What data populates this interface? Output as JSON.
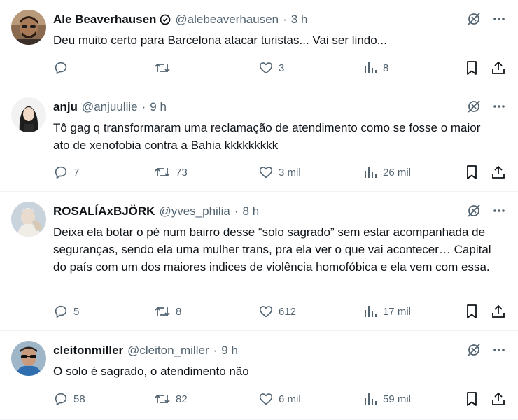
{
  "tweets": [
    {
      "name": "Ale Beaverhausen",
      "handle": "@alebeaverhausen",
      "separator": "·",
      "time": "3 h",
      "verified_icon": "verified-badge-icon",
      "text": "Deu muito certo para Barcelona atacar turistas... Vai ser lindo...",
      "replies": "",
      "retweets": "",
      "likes": "3",
      "views": "8"
    },
    {
      "name": "anju",
      "handle": "@anjuuliie",
      "separator": "·",
      "time": "9 h",
      "text": "Tô gag q transformaram uma reclamação de atendimento como se fosse o maior ato de xenofobia contra a Bahia kkkkkkkkk",
      "replies": "7",
      "retweets": "73",
      "likes": "3 mil",
      "views": "26 mil"
    },
    {
      "name": "ROSALÍAxBJÖRK",
      "handle": "@yves_philia",
      "separator": "·",
      "time": "8 h",
      "text": "Deixa ela botar o pé num bairro desse “solo sagrado” sem estar acompanhada de seguranças, sendo ela uma mulher trans, pra ela ver o que vai acontecer… Capital do país com um dos maiores indices de violência homofóbica e ela vem com essa.",
      "replies": "5",
      "retweets": "8",
      "likes": "612",
      "views": "17 mil"
    },
    {
      "name": "cleitonmiller",
      "handle": "@cleiton_miller",
      "separator": "·",
      "time": "9 h",
      "text": "O solo é sagrado, o atendimento não",
      "replies": "58",
      "retweets": "82",
      "likes": "6 mil",
      "views": "59 mil"
    }
  ],
  "icons": {
    "grok": "grok-icon",
    "more": "more-icon",
    "reply": "reply-icon",
    "retweet": "retweet-icon",
    "like": "like-icon",
    "views": "views-icon",
    "bookmark": "bookmark-icon",
    "share": "share-icon"
  },
  "colors": {
    "text": "#0f1419",
    "secondary": "#536471",
    "divider": "#eff3f4"
  }
}
